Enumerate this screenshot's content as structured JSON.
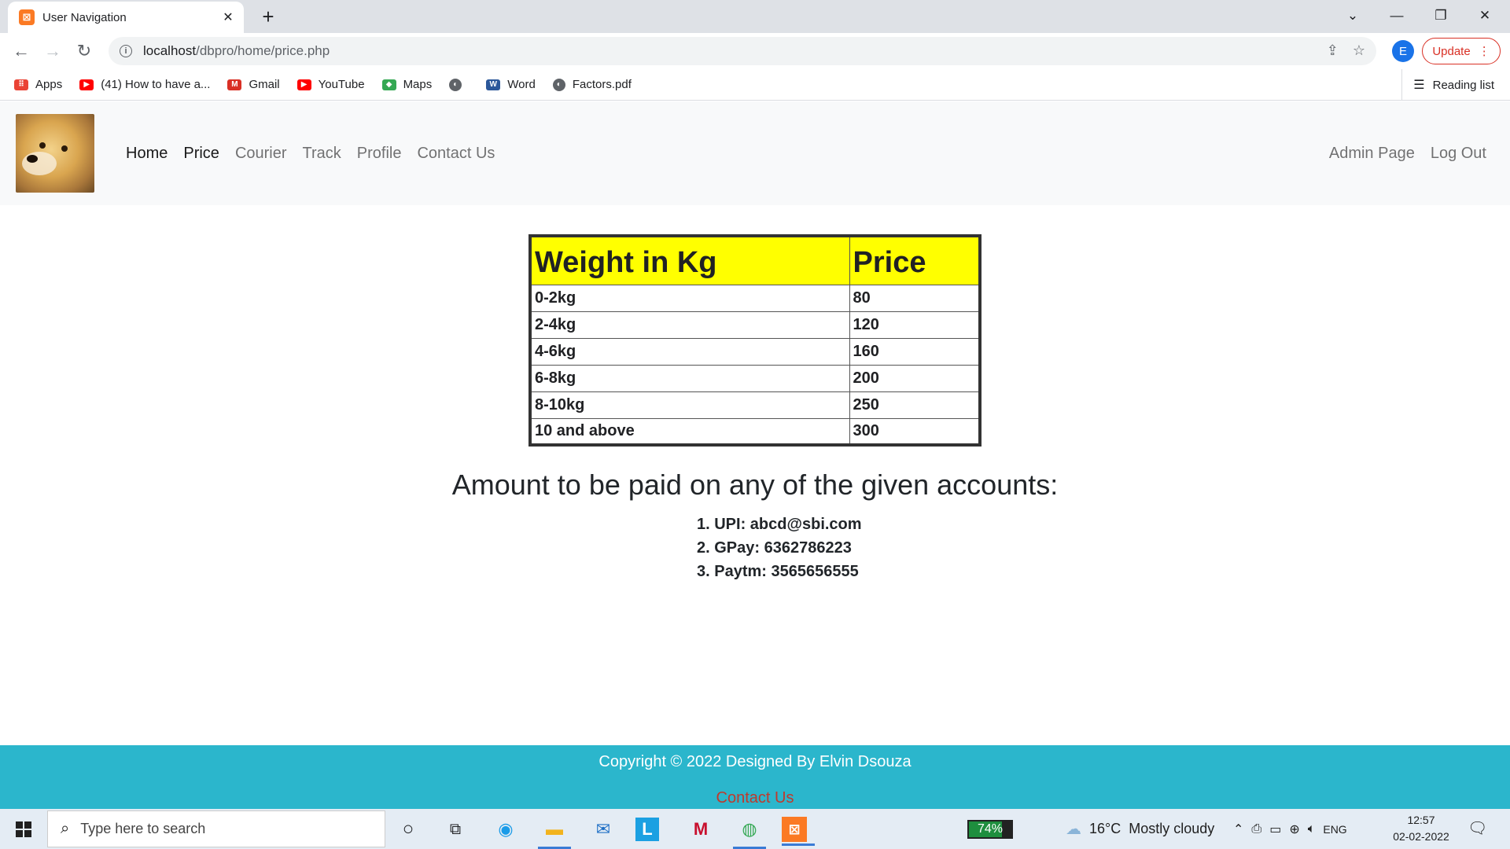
{
  "browser": {
    "tab_title": "User Navigation",
    "tab_close": "✕",
    "new_tab": "+",
    "url_host": "localhost",
    "url_path": "/dbpro/home/price.php",
    "profile_initial": "E",
    "update_label": "Update",
    "bookmarks": [
      {
        "label": "Apps",
        "icon": "apps-grid-icon",
        "color": "#ea4335"
      },
      {
        "label": "(41) How to have a...",
        "icon": "youtube-icon",
        "color": "#ff0000"
      },
      {
        "label": "Gmail",
        "icon": "gmail-icon",
        "color": "#d93025"
      },
      {
        "label": "YouTube",
        "icon": "youtube-icon",
        "color": "#ff0000"
      },
      {
        "label": "Maps",
        "icon": "maps-icon",
        "color": "#34a853"
      },
      {
        "label": "",
        "icon": "globe-icon",
        "color": "#5f6368"
      },
      {
        "label": "Word",
        "icon": "word-icon",
        "color": "#2b579a"
      },
      {
        "label": "Factors.pdf",
        "icon": "globe-icon",
        "color": "#5f6368"
      }
    ],
    "reading_list": "Reading list"
  },
  "site": {
    "nav": {
      "home": "Home",
      "price": "Price",
      "courier": "Courier",
      "track": "Track",
      "profile": "Profile",
      "contact": "Contact Us",
      "admin": "Admin Page",
      "logout": "Log Out"
    },
    "table": {
      "headers": [
        "Weight in Kg",
        "Price"
      ],
      "header_color": "#ffff00",
      "rows": [
        [
          "0-2kg",
          "80"
        ],
        [
          "2-4kg",
          "120"
        ],
        [
          "4-6kg",
          "160"
        ],
        [
          "6-8kg",
          "200"
        ],
        [
          "8-10kg",
          "250"
        ],
        [
          "10 and above",
          "300"
        ]
      ]
    },
    "accounts_title": "Amount to be paid on any of the given accounts:",
    "accounts": [
      "1. UPI: abcd@sbi.com",
      "2. GPay: 6362786223",
      "3. Paytm: 3565656555"
    ],
    "footer": {
      "copyright": "Copyright © 2022 Designed By Elvin Dsouza",
      "contact": "Contact Us",
      "color": "#2bb6cc"
    }
  },
  "taskbar": {
    "search_placeholder": "Type here to search",
    "battery": "74%",
    "temperature": "16°C",
    "weather": "Mostly cloudy",
    "language": "ENG",
    "time": "12:57",
    "date": "02-02-2022"
  }
}
